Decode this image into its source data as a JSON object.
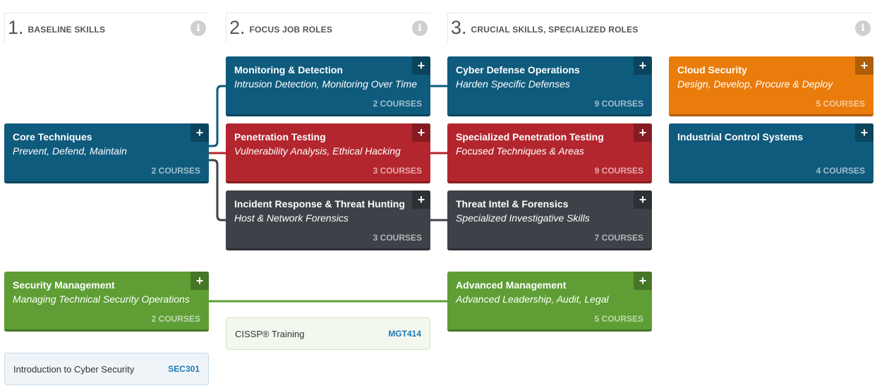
{
  "columns": [
    {
      "num": "1.",
      "title": "BASELINE SKILLS"
    },
    {
      "num": "2.",
      "title": "FOCUS JOB ROLES"
    },
    {
      "num": "3.",
      "title": "CRUCIAL SKILLS, SPECIALIZED ROLES"
    }
  ],
  "info_glyph": "i",
  "plus_glyph": "+",
  "cards": {
    "core": {
      "title": "Core Techniques",
      "subtitle": "Prevent, Defend, Maintain",
      "count": "2 COURSES"
    },
    "monitoring": {
      "title": "Monitoring & Detection",
      "subtitle": "Intrusion Detection, Monitoring Over Time",
      "count": "2 COURSES"
    },
    "pentest": {
      "title": "Penetration Testing",
      "subtitle": "Vulnerability Analysis, Ethical Hacking",
      "count": "3 COURSES"
    },
    "incident": {
      "title": "Incident Response & Threat Hunting",
      "subtitle": "Host & Network Forensics",
      "count": "3 COURSES"
    },
    "cyberdef": {
      "title": "Cyber Defense Operations",
      "subtitle": "Harden Specific Defenses",
      "count": "9 COURSES"
    },
    "specpen": {
      "title": "Specialized Penetration Testing",
      "subtitle": "Focused Techniques & Areas",
      "count": "9 COURSES"
    },
    "threatintel": {
      "title": "Threat Intel & Forensics",
      "subtitle": "Specialized Investigative Skills",
      "count": "7 COURSES"
    },
    "cloud": {
      "title": "Cloud Security",
      "subtitle": "Design, Develop, Procure & Deploy",
      "count": "5 COURSES"
    },
    "ics": {
      "title": "Industrial Control Systems",
      "subtitle": "",
      "count": "4 COURSES"
    },
    "secmgmt": {
      "title": "Security Management",
      "subtitle": "Managing Technical Security Operations",
      "count": "2 COURSES"
    },
    "advmgmt": {
      "title": "Advanced Management",
      "subtitle": "Advanced Leadership, Audit, Legal",
      "count": "5 COURSES"
    }
  },
  "courses": {
    "cissp": {
      "name": "CISSP® Training",
      "code": "MGT414"
    },
    "intro": {
      "name": "Introduction to Cyber Security",
      "code": "SEC301"
    }
  },
  "colors": {
    "blue": "#0f5b7d",
    "red": "#b3262e",
    "dark": "#3d4248",
    "orange": "#ea7c0b",
    "green": "#5e9e34",
    "link_blue": "#1f79b4"
  }
}
